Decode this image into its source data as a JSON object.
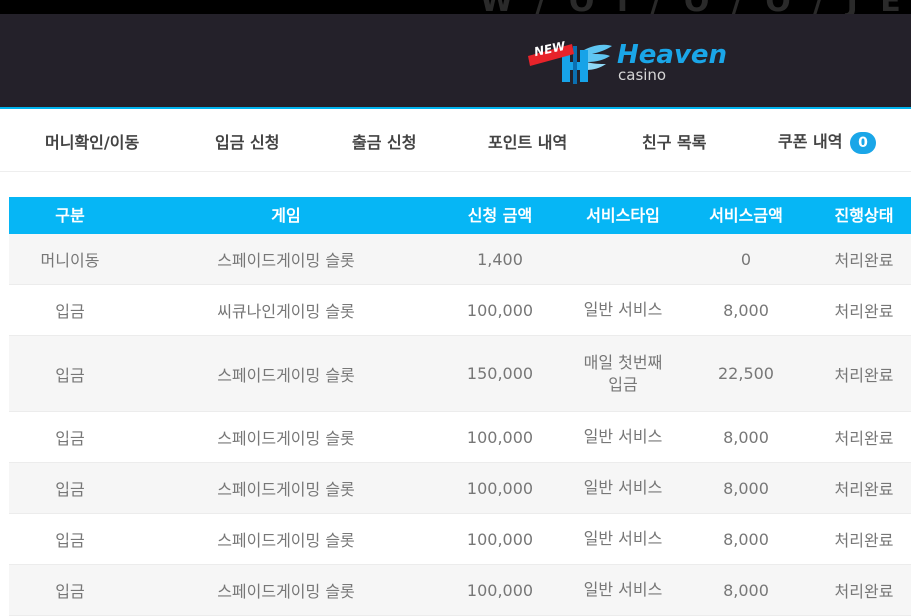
{
  "header": {
    "logo": {
      "badge_text": "NEW",
      "title": "Heaven",
      "subtitle": "casino"
    }
  },
  "nav": {
    "items": [
      {
        "label": "머니확인/이동"
      },
      {
        "label": "입금 신청"
      },
      {
        "label": "출금 신청"
      },
      {
        "label": "포인트 내역"
      },
      {
        "label": "친구 목록"
      },
      {
        "label": "쿠폰 내역",
        "badge": "0"
      }
    ]
  },
  "table": {
    "columns": [
      "구분",
      "게임",
      "신청 금액",
      "서비스타입",
      "서비스금액",
      "진행상태"
    ],
    "rows": [
      [
        "머니이동",
        "스페이드게이밍 슬롯",
        "1,400",
        "",
        "0",
        "처리완료"
      ],
      [
        "입금",
        "씨큐나인게이밍 슬롯",
        "100,000",
        "일반 서비스",
        "8,000",
        "처리완료"
      ],
      [
        "입금",
        "스페이드게이밍 슬롯",
        "150,000",
        "매일 첫번째 입금",
        "22,500",
        "처리완료"
      ],
      [
        "입금",
        "스페이드게이밍 슬롯",
        "100,000",
        "일반 서비스",
        "8,000",
        "처리완료"
      ],
      [
        "입금",
        "스페이드게이밍 슬롯",
        "100,000",
        "일반 서비스",
        "8,000",
        "처리완료"
      ],
      [
        "입금",
        "스페이드게이밍 슬롯",
        "100,000",
        "일반 서비스",
        "8,000",
        "처리완료"
      ],
      [
        "입금",
        "스페이드게이밍 슬롯",
        "100,000",
        "일반 서비스",
        "8,000",
        "처리완료"
      ]
    ]
  },
  "colors": {
    "header_bg": "#24212a",
    "accent": "#06b6f5",
    "row_alt": "#f6f6f6"
  }
}
